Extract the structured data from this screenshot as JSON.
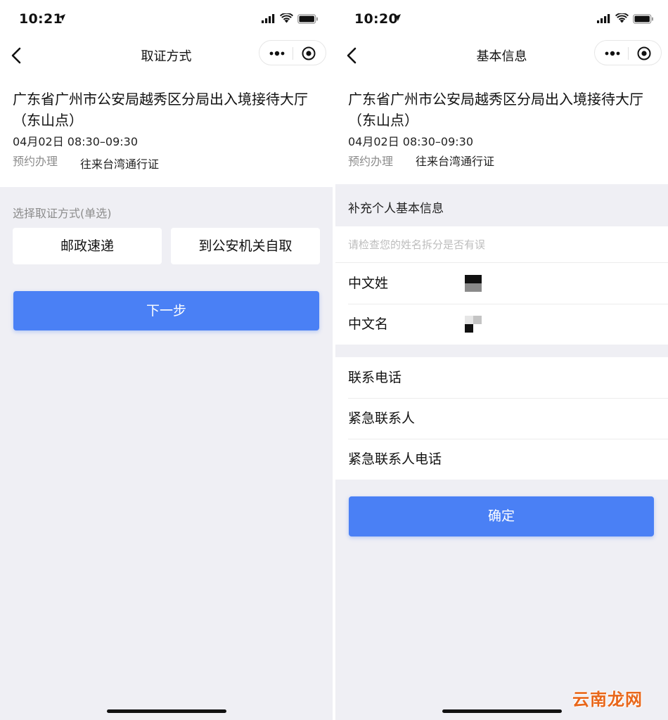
{
  "left": {
    "status_time": "10:21",
    "nav_title": "取证方式",
    "office": "广东省广州市公安局越秀区分局出入境接待大厅（东山点）",
    "datetime": "04月02日 08:30–09:30",
    "service_label": "预约办理",
    "service_value": "往来台湾通行证",
    "choose_tip": "选择取证方式(单选)",
    "option_post": "邮政速递",
    "option_self": "到公安机关自取",
    "next_button": "下一步"
  },
  "right": {
    "status_time": "10:20",
    "nav_title": "基本信息",
    "office": "广东省广州市公安局越秀区分局出入境接待大厅（东山点）",
    "datetime": "04月02日 08:30–09:30",
    "service_label": "预约办理",
    "service_value": "往来台湾通行证",
    "section_title": "补充个人基本信息",
    "name_hint": "请检查您的姓名拆分是否有误",
    "surname_label": "中文姓",
    "givenname_label": "中文名",
    "phone_label": "联系电话",
    "emergency_contact_label": "紧急联系人",
    "emergency_phone_label": "紧急联系人电话",
    "confirm_button": "确定"
  },
  "watermark": "云南龙网",
  "colors": {
    "primary": "#4a80f5",
    "background": "#efeff4",
    "watermark": "#e8671b"
  },
  "icons": [
    "location-arrow-icon",
    "signal-icon",
    "wifi-icon",
    "battery-icon",
    "back-chevron-icon",
    "more-dots-icon",
    "close-target-icon"
  ]
}
